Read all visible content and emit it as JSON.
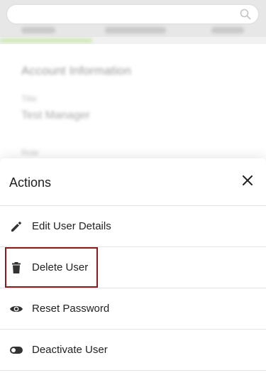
{
  "background": {
    "card": {
      "title": "Account Information",
      "label": "Title",
      "value": "Test Manager",
      "label2": "Role"
    }
  },
  "sheet": {
    "title": "Actions",
    "items": [
      {
        "label": "Edit User Details",
        "icon": "pencil-icon"
      },
      {
        "label": "Delete User",
        "icon": "trash-icon"
      },
      {
        "label": "Reset Password",
        "icon": "eye-icon"
      },
      {
        "label": "Deactivate User",
        "icon": "toggle-icon"
      }
    ]
  },
  "colors": {
    "highlight": "#8b1a1a",
    "text": "#222222",
    "divider": "#e3e3e3"
  }
}
